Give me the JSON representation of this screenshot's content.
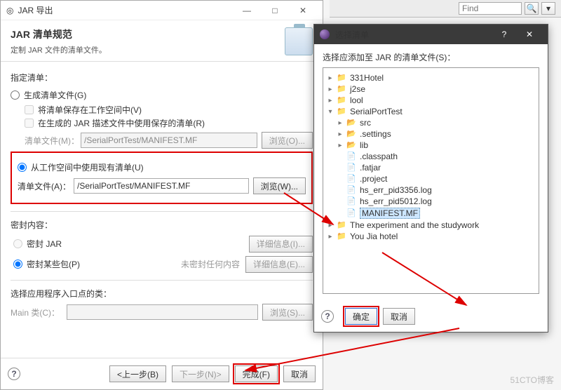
{
  "find": {
    "placeholder": "Find"
  },
  "dialog1": {
    "title": "JAR 导出",
    "heading": "JAR 清单规范",
    "subheading": "定制 JAR 文件的清单文件。",
    "specify_label": "指定清单：",
    "radio_generate": "生成清单文件(G)",
    "cb_save_workspace": "将清单保存在工作空间中(V)",
    "cb_use_saved": "在生成的 JAR 描述文件中使用保存的清单(R)",
    "manifest_m_label": "清单文件(M)：",
    "manifest_m_value": "/SerialPortTest/MANIFEST.MF",
    "browse_o": "浏览(O)...",
    "radio_use_existing": "从工作空间中使用现有清单(U)",
    "manifest_a_label": "清单文件(A)：",
    "manifest_a_value": "/SerialPortTest/MANIFEST.MF",
    "browse_w": "浏览(W)...",
    "sealing_label": "密封内容：",
    "radio_seal_jar": "密封 JAR",
    "details_i": "详细信息(I)...",
    "radio_seal_pkgs": "密封某些包(P)",
    "sealed_none": "未密封任何内容",
    "details_e": "详细信息(E)...",
    "entry_label": "选择应用程序入口点的类：",
    "main_class_label": "Main 类(C)：",
    "browse_s": "浏览(S)...",
    "btn_back": "<上一步(B)",
    "btn_next": "下一步(N)>",
    "btn_finish": "完成(F)",
    "btn_cancel": "取消"
  },
  "dialog2": {
    "title": "选择清单",
    "prompt": "选择应添加至 JAR 的清单文件(S)：",
    "btn_ok": "确定",
    "btn_cancel": "取消",
    "tree": [
      {
        "depth": 0,
        "exp": "▸",
        "icon": "proj",
        "label": "331Hotel"
      },
      {
        "depth": 0,
        "exp": "▸",
        "icon": "proj",
        "label": "j2se"
      },
      {
        "depth": 0,
        "exp": "▸",
        "icon": "proj",
        "label": "lool"
      },
      {
        "depth": 0,
        "exp": "▾",
        "icon": "proj",
        "label": "SerialPortTest"
      },
      {
        "depth": 1,
        "exp": "▸",
        "icon": "folder",
        "label": "src"
      },
      {
        "depth": 1,
        "exp": "▸",
        "icon": "folder",
        "label": ".settings"
      },
      {
        "depth": 1,
        "exp": "▸",
        "icon": "folder",
        "label": "lib"
      },
      {
        "depth": 1,
        "exp": "",
        "icon": "file",
        "label": ".classpath"
      },
      {
        "depth": 1,
        "exp": "",
        "icon": "file",
        "label": ".fatjar"
      },
      {
        "depth": 1,
        "exp": "",
        "icon": "file",
        "label": ".project"
      },
      {
        "depth": 1,
        "exp": "",
        "icon": "file",
        "label": "hs_err_pid3356.log"
      },
      {
        "depth": 1,
        "exp": "",
        "icon": "file",
        "label": "hs_err_pid5012.log"
      },
      {
        "depth": 1,
        "exp": "",
        "icon": "file",
        "label": "MANIFEST.MF",
        "selected": true
      },
      {
        "depth": 0,
        "exp": "▸",
        "icon": "proj",
        "label": "The experiment and the studywork"
      },
      {
        "depth": 0,
        "exp": "▸",
        "icon": "proj",
        "label": "You Jia hotel"
      }
    ]
  },
  "watermark": "51CTO博客"
}
